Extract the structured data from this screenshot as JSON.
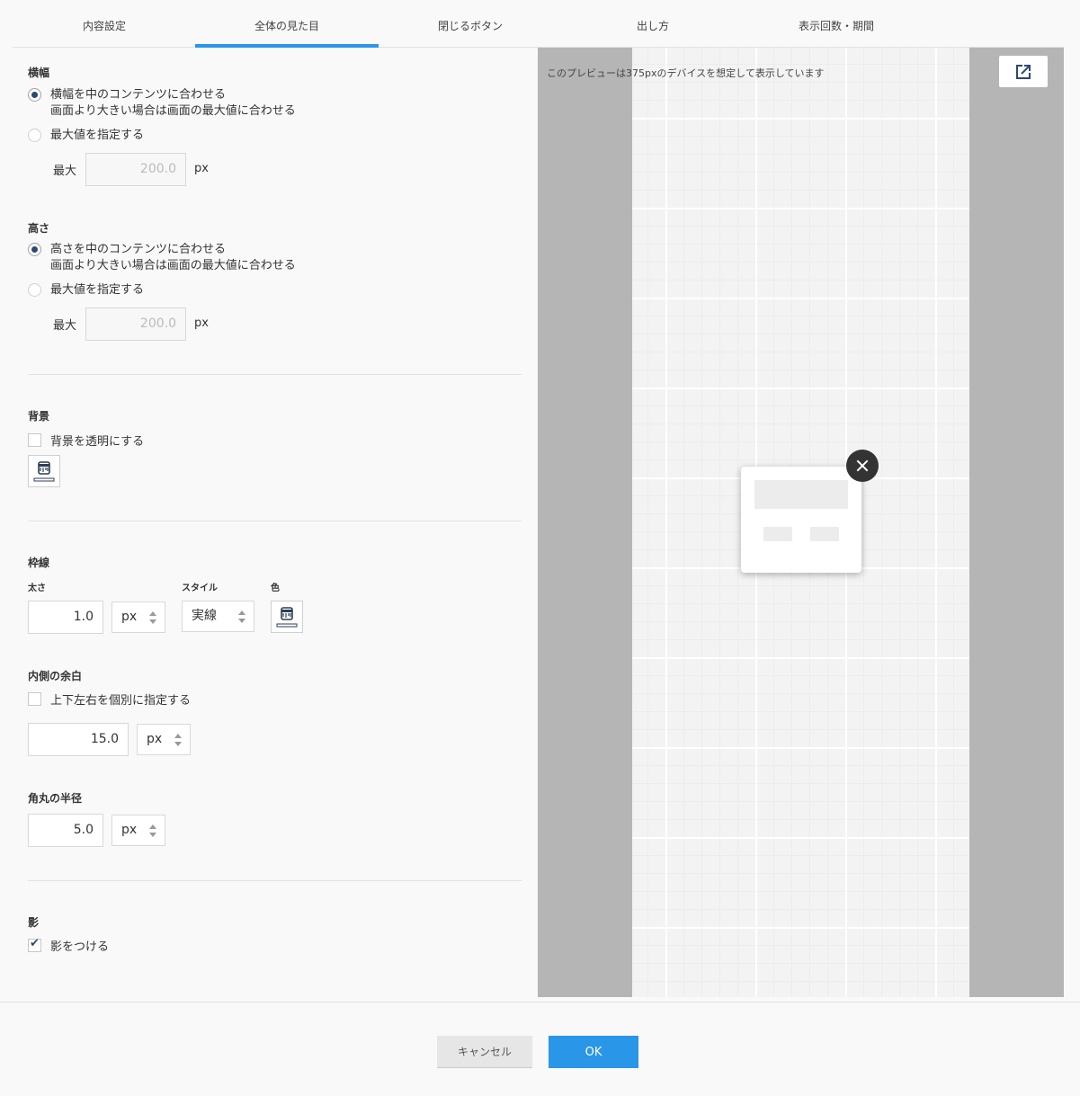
{
  "tabs": [
    {
      "label": "内容設定",
      "active": false
    },
    {
      "label": "全体の見た目",
      "active": true
    },
    {
      "label": "閉じるボタン",
      "active": false
    },
    {
      "label": "出し方",
      "active": false
    },
    {
      "label": "表示回数・期間",
      "active": false
    }
  ],
  "width": {
    "title": "横幅",
    "option_fit_line1": "横幅を中のコンテンツに合わせる",
    "option_fit_line2": "画面より大きい場合は画面の最大値に合わせる",
    "option_max": "最大値を指定する",
    "max_label": "最大",
    "max_value": "200.0",
    "unit": "px",
    "selected": "fit"
  },
  "height": {
    "title": "高さ",
    "option_fit_line1": "高さを中のコンテンツに合わせる",
    "option_fit_line2": "画面より大きい場合は画面の最大値に合わせる",
    "option_max": "最大値を指定する",
    "max_label": "最大",
    "max_value": "200.0",
    "unit": "px",
    "selected": "fit"
  },
  "background": {
    "title": "背景",
    "transparent_label": "背景を透明にする",
    "transparent_checked": false
  },
  "border": {
    "title": "枠線",
    "thickness_label": "太さ",
    "thickness_value": "1.0",
    "thickness_unit": "px",
    "style_label": "スタイル",
    "style_value": "実線",
    "color_label": "色"
  },
  "padding": {
    "title": "内側の余白",
    "individual_label": "上下左右を個別に指定する",
    "individual_checked": false,
    "value": "15.0",
    "unit": "px"
  },
  "radius": {
    "title": "角丸の半径",
    "value": "5.0",
    "unit": "px"
  },
  "shadow": {
    "title": "影",
    "label": "影をつける",
    "checked": true
  },
  "preview": {
    "note": "このプレビューは375pxのデバイスを想定して表示しています",
    "icon": "external-link-icon"
  },
  "footer": {
    "cancel_label": "キャンセル",
    "ok_label": "OK"
  },
  "colors": {
    "accent": "#2996e8",
    "radio_dot": "#2c4a70",
    "close_button": "#333333"
  }
}
